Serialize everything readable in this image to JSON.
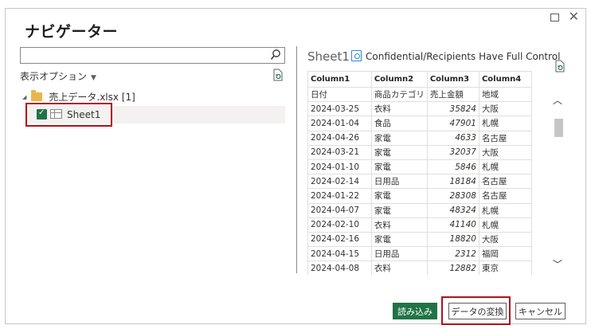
{
  "dialog": {
    "title": "ナビゲーター"
  },
  "left": {
    "search": {
      "value": "",
      "placeholder": ""
    },
    "display_options_label": "表示オプション",
    "tree": {
      "file_label": "売上データ.xlsx [1]",
      "sheet_label": "Sheet1",
      "sheet_checked": true
    }
  },
  "preview": {
    "title": "Sheet1",
    "sensitivity_label": "Confidential/Recipients Have Full Control",
    "columns": [
      "Column1",
      "Column2",
      "Column3",
      "Column4"
    ],
    "rows": [
      [
        "日付",
        "商品カテゴリ",
        "売上金額",
        "地域"
      ],
      [
        "2024-03-25",
        "衣料",
        "35824",
        "大阪"
      ],
      [
        "2024-01-04",
        "食品",
        "47901",
        "札幌"
      ],
      [
        "2024-04-26",
        "家電",
        "4633",
        "名古屋"
      ],
      [
        "2024-03-21",
        "家電",
        "32037",
        "大阪"
      ],
      [
        "2024-01-10",
        "家電",
        "5846",
        "札幌"
      ],
      [
        "2024-02-14",
        "日用品",
        "18184",
        "名古屋"
      ],
      [
        "2024-01-22",
        "家電",
        "28308",
        "名古屋"
      ],
      [
        "2024-04-07",
        "家電",
        "48324",
        "札幌"
      ],
      [
        "2024-02-10",
        "衣料",
        "41140",
        "札幌"
      ],
      [
        "2024-02-16",
        "家電",
        "18820",
        "大阪"
      ],
      [
        "2024-04-15",
        "日用品",
        "2312",
        "福岡"
      ],
      [
        "2024-04-08",
        "衣料",
        "12882",
        "東京"
      ]
    ]
  },
  "footer": {
    "load_label": "読み込み",
    "transform_label": "データの変換",
    "cancel_label": "キャンセル"
  },
  "colors": {
    "primary_green": "#217346",
    "highlight_red": "#b0111a"
  },
  "icons": {
    "search": "search-icon",
    "refresh": "refresh-icon",
    "folder": "folder-icon",
    "sheet": "table-icon",
    "sensitivity": "sensitivity-label-icon"
  }
}
